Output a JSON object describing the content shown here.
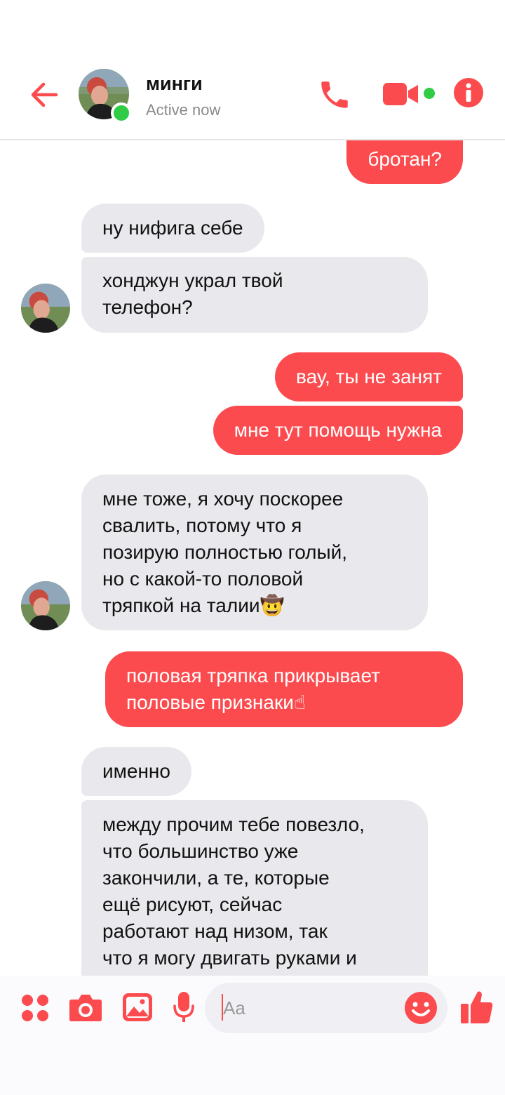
{
  "header": {
    "contact_name": "минги",
    "status": "Active now",
    "icons": [
      "back-arrow-icon",
      "avatar",
      "phone-icon",
      "video-camera-icon",
      "info-icon"
    ]
  },
  "messages": [
    {
      "dir": "out",
      "text": "бротан?"
    },
    {
      "dir": "in",
      "text": "ну нифига себе"
    },
    {
      "dir": "in",
      "text": "хонджун украл твой\nтелефон?"
    },
    {
      "dir": "out",
      "text": "вау, ты не занят"
    },
    {
      "dir": "out",
      "text": "мне тут помощь нужна"
    },
    {
      "dir": "in",
      "text": "мне тоже, я хочу поскорее\nсвалить, потому что я\nпозирую полностью голый,\nно с какой-то половой\nтряпкой на талии🤠"
    },
    {
      "dir": "out",
      "text": "половая тряпка прикрывает\nполовые признаки☝"
    },
    {
      "dir": "in",
      "text": "именно"
    },
    {
      "dir": "in",
      "text": "между прочим тебе повезло,\nчто большинство уже\nзакончили, а те, которые\nещё рисуют, сейчас\nработают над низом, так\nчто я могу двигать руками и"
    }
  ],
  "composer": {
    "placeholder": "Aa",
    "icons": [
      "apps-grid-icon",
      "camera-icon",
      "gallery-icon",
      "microphone-icon",
      "emoji-icon",
      "thumbs-up-icon"
    ]
  },
  "colors": {
    "accent": "#fb4b4e",
    "incoming_bubble": "#e9e8ec",
    "online": "#31cc46"
  }
}
